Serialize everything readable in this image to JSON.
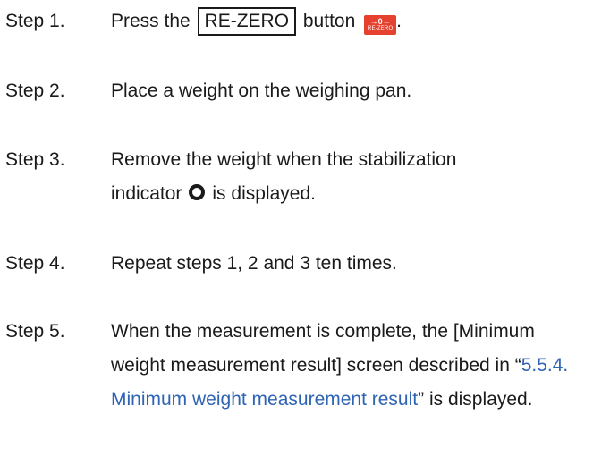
{
  "steps": [
    {
      "label": "Step 1.",
      "text_before": "Press the ",
      "button_label": "RE-ZERO",
      "text_mid": " button ",
      "icon": {
        "name": "re-zero-icon",
        "top": "→0←",
        "bottom": "RE-ZERO",
        "color": "#e5412e"
      },
      "text_after": "."
    },
    {
      "label": "Step 2.",
      "text": "Place a weight on the weighing pan."
    },
    {
      "label": "Step 3.",
      "text_before": "Remove the weight when the stabilization indicator",
      "icon": {
        "name": "stabilization-indicator-icon"
      },
      "text_after": "is displayed."
    },
    {
      "label": "Step 4.",
      "text": "Repeat steps 1, 2 and 3 ten times."
    },
    {
      "label": "Step 5.",
      "text_before": "When the measurement is complete, the [Minimum weight measurement result] screen described in “",
      "link_text": "5.5.4. Minimum weight measurement result",
      "text_after": "” is displayed.",
      "link_color": "#2f64b4"
    }
  ]
}
